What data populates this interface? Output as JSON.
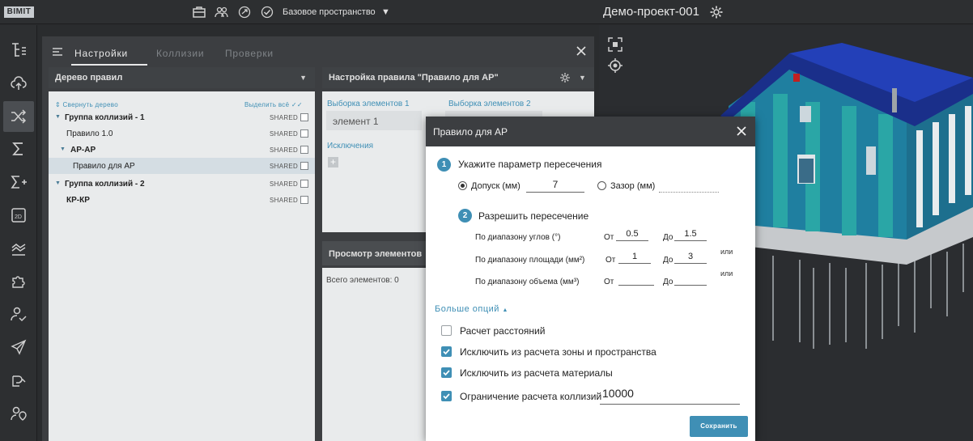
{
  "topbar": {
    "logo": "BIMIT",
    "space_label": "Базовое пространство",
    "space_caret": "▼",
    "project_name": "Демо-проект-001",
    "icons": [
      "briefcase-icon",
      "users-icon",
      "share-icon",
      "check-circle-icon",
      "gear-icon"
    ]
  },
  "rail": {
    "active_index": 2,
    "icons": [
      "tree-icon",
      "cloud-upload-icon",
      "shuffle-icon",
      "sigma-icon",
      "sigma-plus-icon",
      "2d-icon",
      "graph-icon",
      "puzzle-icon",
      "user-check-icon",
      "send-icon",
      "link-icon",
      "user-location-icon"
    ]
  },
  "panel": {
    "tabs": [
      {
        "label": "Настройки",
        "active": true
      },
      {
        "label": "Коллизии",
        "active": false
      },
      {
        "label": "Проверки",
        "active": false
      }
    ]
  },
  "tree": {
    "title": "Дерево правил",
    "caret": "▼",
    "collapse_label": "Свернуть дерево",
    "select_all_label": "Выделить всё",
    "rows": [
      {
        "label": "Группа коллизий - 1",
        "badge": "SHARED",
        "bold": true,
        "arrow": true
      },
      {
        "label": "Правило 1.0",
        "badge": "SHARED",
        "bold": false,
        "arrow": false
      },
      {
        "label": "АР-АР",
        "badge": "SHARED",
        "bold": true,
        "arrow": true
      },
      {
        "label": "Правило для АР",
        "badge": "SHARED",
        "bold": false,
        "arrow": false,
        "selected": true
      },
      {
        "label": "Группа коллизий - 2",
        "badge": "SHARED",
        "bold": true,
        "arrow": true
      },
      {
        "label": "КР-КР",
        "badge": "SHARED",
        "bold": true,
        "arrow": false
      }
    ]
  },
  "settings": {
    "title": "Настройка правила \"Правило для АР\"",
    "caret": "▼",
    "selection1_label": "Выборка элементов 1",
    "selection2_label": "Выборка элементов 2",
    "element1": "элемент 1",
    "exclusions_label": "Исключения",
    "add": "+"
  },
  "viewer": {
    "title": "Просмотр элементов",
    "total_label": "Всего элементов: 0"
  },
  "modal": {
    "title": "Правило для АР",
    "step1": {
      "number": "1",
      "label": "Укажите параметр пересечения"
    },
    "tolerance": {
      "label": "Допуск (мм)",
      "value": "7",
      "selected": true
    },
    "gap": {
      "label": "Зазор (мм)",
      "value": "",
      "selected": false
    },
    "step2": {
      "number": "2",
      "label": "Разрешить пересечение"
    },
    "ranges": [
      {
        "label": "По диапазону углов (°)",
        "from_label": "От",
        "from": "0.5",
        "to_label": "До",
        "to": "1.5",
        "or": ""
      },
      {
        "label": "По диапазону площади (мм²)",
        "from_label": "От",
        "from": "1",
        "to_label": "До",
        "to": "3",
        "or": "или"
      },
      {
        "label": "По диапазону объема (мм³)",
        "from_label": "От",
        "from": "",
        "to_label": "До",
        "to": "",
        "or": "или"
      }
    ],
    "more_options": "Больше опций",
    "checkboxes": [
      {
        "label": "Расчет расстояний",
        "checked": false
      },
      {
        "label": "Исключить из расчета зоны и пространства",
        "checked": true
      },
      {
        "label": "Исключить из расчета материалы",
        "checked": true
      },
      {
        "label": "Ограничение расчета коллизий",
        "checked": true
      }
    ],
    "collision_limit": "10000",
    "save_label": "Сохранить"
  },
  "colors": {
    "accent": "#3f8fb5",
    "dark_bg": "#2d2f31",
    "panel_bg": "#3c3e41",
    "content_bg": "#e9ebec"
  }
}
